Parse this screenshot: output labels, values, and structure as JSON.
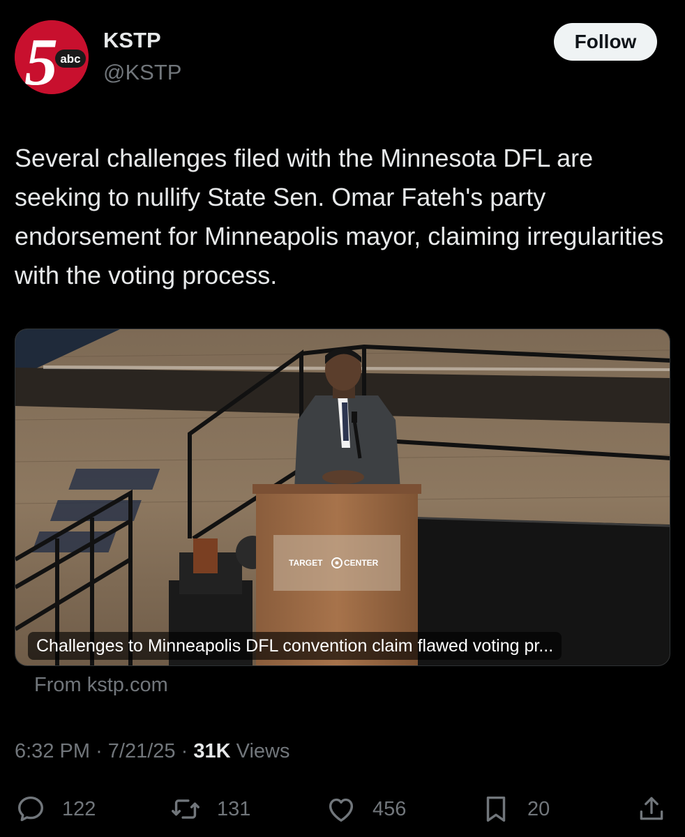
{
  "author": {
    "display_name": "KSTP",
    "handle": "@KSTP",
    "avatar_text": "5",
    "avatar_sub": "abc"
  },
  "follow_label": "Follow",
  "tweet_text": "Several challenges filed with the Minnesota DFL are seeking to nullify State Sen. Omar Fateh's party endorsement for Minneapolis mayor, claiming irregularities with the voting process.",
  "media": {
    "caption": "Challenges to Minneapolis DFL convention claim flawed voting pr...",
    "podium_sign": "TARGET",
    "podium_sign_2": "CENTER"
  },
  "source": "From kstp.com",
  "meta": {
    "time": "6:32 PM",
    "date": "7/21/25",
    "views_count": "31K",
    "views_label": "Views",
    "separator": "·"
  },
  "actions": {
    "replies": "122",
    "reposts": "131",
    "likes": "456",
    "bookmarks": "20"
  },
  "colors": {
    "background": "#000000",
    "text_primary": "#e7e9ea",
    "text_secondary": "#71767b",
    "brand_red": "#c8102e"
  }
}
